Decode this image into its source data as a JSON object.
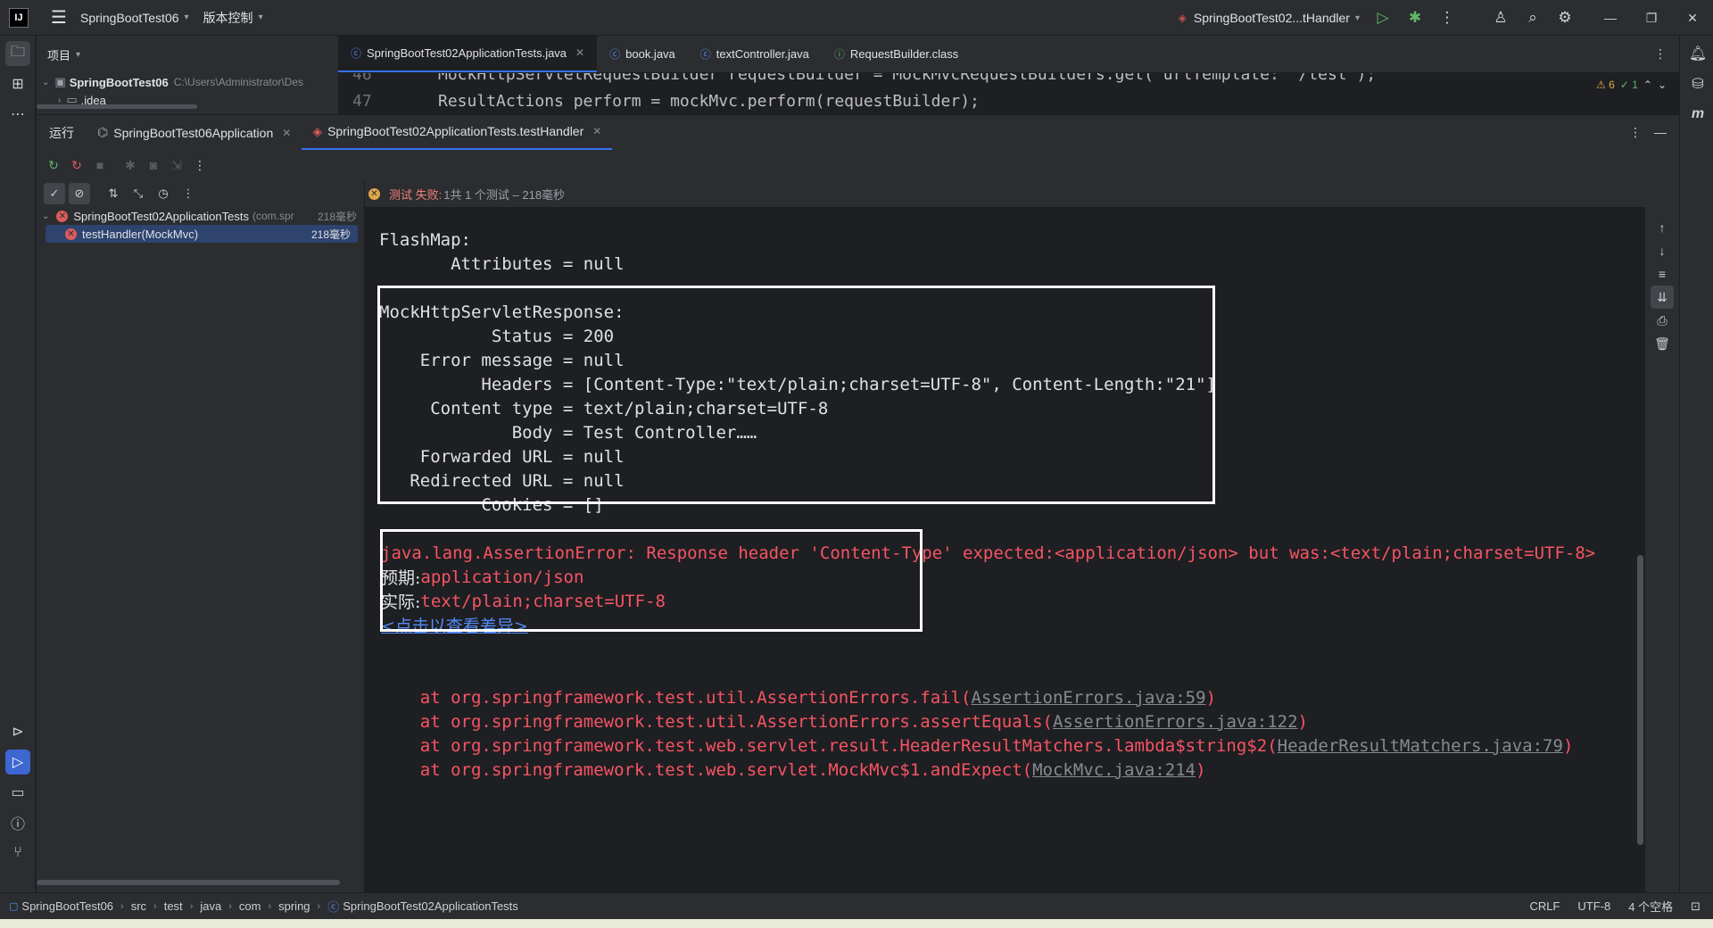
{
  "titlebar": {
    "logo": "IJ",
    "project_name": "SpringBootTest06",
    "vcs_menu": "版本控制",
    "run_config": "SpringBootTest02...tHandler"
  },
  "project_panel": {
    "title": "项目",
    "root_name": "SpringBootTest06",
    "root_path": "C:\\Users\\Administrator\\Des",
    "child": ".idea"
  },
  "editor_tabs": [
    {
      "label": "SpringBootTest02ApplicationTests.java",
      "icon": "class-icon"
    },
    {
      "label": "book.java",
      "icon": "class-icon"
    },
    {
      "label": "textController.java",
      "icon": "class-icon"
    },
    {
      "label": "RequestBuilder.class",
      "icon": "interface-icon"
    }
  ],
  "editor": {
    "line_prev_num": "46",
    "line_prev_code": "MockHttpServletRequestBuilder requestBuilder = MockMvcRequestBuilders.get( urlTemplate: \"/test\");",
    "line_num": "47",
    "line_code": "ResultActions perform = mockMvc.perform(requestBuilder);",
    "warnings": "⚠ 6",
    "checks": "✓ 1"
  },
  "run_panel": {
    "label": "运行",
    "tabs": [
      "SpringBootTest06Application",
      "SpringBootTest02ApplicationTests.testHandler"
    ]
  },
  "test_tree": {
    "root_label": "SpringBootTest02ApplicationTests",
    "root_pkg": "(com.spr",
    "root_time": "218毫秒",
    "child_label": "testHandler(MockMvc)",
    "child_time": "218毫秒"
  },
  "status": {
    "fail": "测试 失败:",
    "info": "1共 1 个测试 – 218毫秒"
  },
  "console": {
    "flashmap": "FlashMap:",
    "flash_attrs": "       Attributes = null",
    "response_lines": [
      "MockHttpServletResponse:",
      "           Status = 200",
      "    Error message = null",
      "          Headers = [Content-Type:\"text/plain;charset=UTF-8\", Content-Length:\"21\"]",
      "     Content type = text/plain;charset=UTF-8",
      "             Body = Test Controller……",
      "    Forwarded URL = null",
      "   Redirected URL = null",
      "          Cookies = []"
    ],
    "assert_error": "java.lang.AssertionError: Response header 'Content-Type' expected:<application/json> but was:<text/plain;charset=UTF-8>",
    "expected_label": "预期:",
    "expected_value": "application/json",
    "actual_label": "实际:",
    "actual_value": "text/plain;charset=UTF-8",
    "diff_link": "<点击以查看差异>",
    "trace": [
      {
        "text": "    at org.springframework.test.util.AssertionErrors.fail(",
        "link": "AssertionErrors.java:59",
        "end": ")"
      },
      {
        "text": "    at org.springframework.test.util.AssertionErrors.assertEquals(",
        "link": "AssertionErrors.java:122",
        "end": ")"
      },
      {
        "text": "    at org.springframework.test.web.servlet.result.HeaderResultMatchers.lambda$string$2(",
        "link": "HeaderResultMatchers.java:79",
        "end": ")"
      },
      {
        "text": "    at org.springframework.test.web.servlet.MockMvc$1.andExpect(",
        "link": "MockMvc.java:214",
        "end": ")"
      }
    ]
  },
  "statusbar": {
    "breadcrumbs": [
      "SpringBootTest06",
      "src",
      "test",
      "java",
      "com",
      "spring",
      "SpringBootTest02ApplicationTests"
    ],
    "line_sep": "CRLF",
    "encoding": "UTF-8",
    "indent": "4 个空格"
  }
}
